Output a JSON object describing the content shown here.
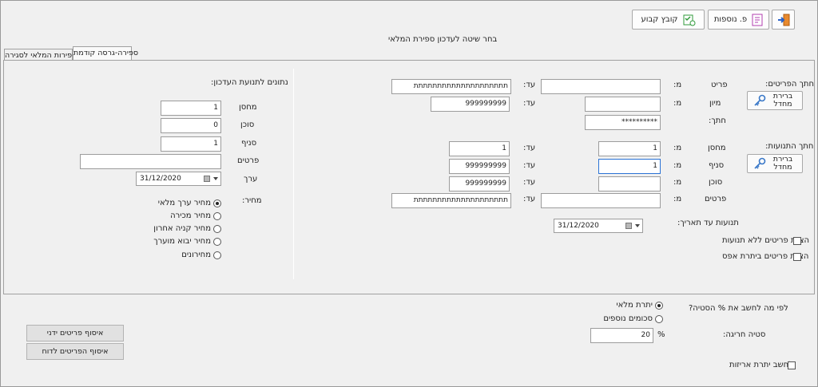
{
  "toolbar": {
    "exit_icon": "exit-door-icon",
    "extras_label": "פ. נוספות",
    "extras_icon": "document-plus-icon",
    "save_label": "קובץ קבוע",
    "save_icon": "save-checklist-icon"
  },
  "page_title": "בחר שיטה לעדכון ספירת המלאי",
  "tabs": [
    {
      "label": "ספירה-גרסה קודמת",
      "active": true
    },
    {
      "label": "ספירות המלאי לסגירה",
      "active": false
    }
  ],
  "item_selection": {
    "title": "חתך הפריטים:",
    "button_label": "ברירת מחדל",
    "key_icon": "key-icon",
    "from_label": "מ:",
    "to_label": "עד:",
    "item_label": "פריט",
    "item_from": "",
    "item_to": "תתתתתתתתתתתתתתתתתתתת",
    "sort_label": "מיון",
    "sort_from": "",
    "sort_to": "999999999",
    "cut_label": "חתך:",
    "cut_value": "**********"
  },
  "transaction_selection": {
    "title": "חתך התנועות:",
    "button_label": "ברירת מחדל",
    "key_icon": "key-icon",
    "warehouse_label": "מחסן",
    "warehouse_from": "1",
    "warehouse_to": "1",
    "branch_label": "סניף",
    "branch_from": "1",
    "branch_to": "999999999",
    "agent_label": "סוכן",
    "agent_from": "",
    "agent_to": "999999999",
    "details_label": "פרטים",
    "details_from": "",
    "details_to": "תתתתתתתתתתתתתתתתתתתת",
    "date_label": "תנועות עד תאריך:",
    "date_value": "31/12/2020"
  },
  "checkboxes": {
    "no_movement": "הצגת פריטים ללא תנועות",
    "zero_balance": "הצגת פריטים ביתרת אפס"
  },
  "update_data": {
    "title": "נתונים לתנועת העדכון:",
    "warehouse_label": "מחסן",
    "warehouse_value": "1",
    "agent_label": "סוכן",
    "agent_value": "0",
    "branch_label": "סניף",
    "branch_value": "1",
    "details_label": "פרטים",
    "details_value": "",
    "date_label": "ערך",
    "date_value": "31/12/2020",
    "price_label": "מחיר:",
    "price_options": [
      {
        "label": "מחיר ערך מלאי",
        "selected": true
      },
      {
        "label": "מחיר מכירה",
        "selected": false
      },
      {
        "label": "מחיר קניה אחרון",
        "selected": false
      },
      {
        "label": "מחיר יבוא מוערך",
        "selected": false
      },
      {
        "label": "מחירונים",
        "selected": false
      }
    ]
  },
  "bottom": {
    "calc_question": "לפי מה לחשב את % הסטיה?",
    "calc_options": [
      {
        "label": "יתרת מלאי",
        "selected": true
      },
      {
        "label": "סכומים נוספים",
        "selected": false
      }
    ],
    "deviation_label": "סטיה חריגה:",
    "deviation_value": "20",
    "percent_sign": "%",
    "batch_calc_label": "לחשב יתרת אריזות",
    "collect_manual_label": "איסוף פריטים ידני",
    "collect_report_label": "איסוף הפריטים לדוח"
  }
}
